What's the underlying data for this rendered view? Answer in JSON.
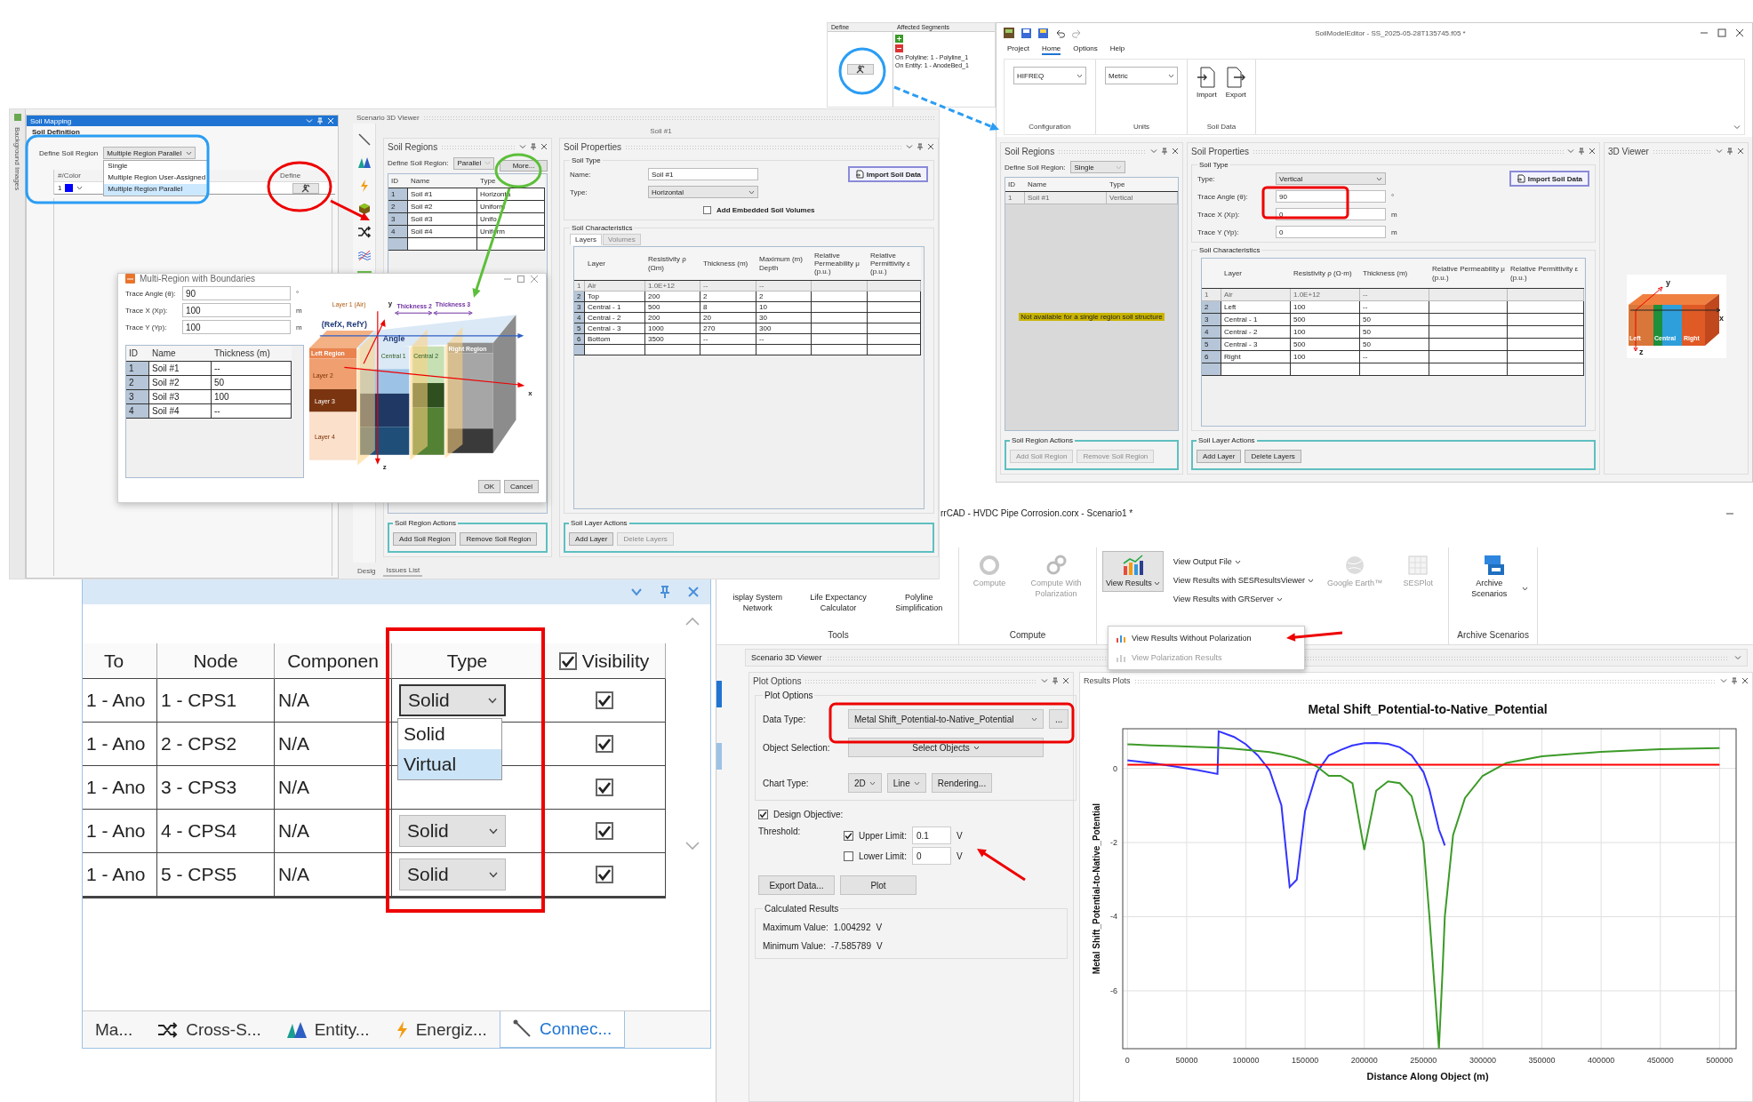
{
  "soil_mapping_screen": {
    "side_tab": "Background Images",
    "soil_mapping": {
      "title": "Soil Mapping",
      "section": "Soil Definition",
      "define_label": "Define Soil Region",
      "define_value": "Multiple Region Parallel",
      "options": [
        {
          "label": "Single",
          "selected": false
        },
        {
          "label": "Multiple Region User-Assigned",
          "selected": false
        },
        {
          "label": "Multiple Region Parallel",
          "selected": true
        }
      ],
      "columns": [
        "#/Color",
        "Define"
      ],
      "rows": [
        {
          "id": "1",
          "color": "#0000ff"
        }
      ]
    },
    "viewer": {
      "title": "Scenario 3D Viewer",
      "caption": "Soil #1",
      "bottom_tabs": [
        {
          "label": "Desig",
          "selected": false
        },
        {
          "label": "Issues List",
          "selected": true
        }
      ]
    },
    "soil_regions": {
      "title": "Soil Regions",
      "define_label": "Define Soil Region:",
      "define_value": "Parallel",
      "more_button": "More...",
      "columns": [
        "ID",
        "Name",
        "Type"
      ],
      "rows": [
        {
          "cells": [
            "1",
            "Soil #1",
            "Horizonta"
          ]
        },
        {
          "cells": [
            "2",
            "Soil #2",
            "Uniform"
          ]
        },
        {
          "cells": [
            "3",
            "Soil #3",
            "Unifo"
          ]
        },
        {
          "cells": [
            "4",
            "Soil #4",
            "Uniform"
          ]
        }
      ],
      "actions_title": "Soil Region Actions",
      "actions": [
        {
          "label": "Add Soil Region",
          "disabled": false
        },
        {
          "label": "Remove Soil Region",
          "disabled": false
        }
      ]
    },
    "soil_properties": {
      "title": "Soil Properties",
      "soil_type_title": "Soil Type",
      "fields": [
        {
          "label": "Name:",
          "value": "Soil #1",
          "kind": "text"
        },
        {
          "label": "Type:",
          "value": "Horizontal",
          "kind": "dropdown"
        }
      ],
      "import_button": "Import Soil Data",
      "embedded": {
        "label": "Add Embedded Soil Volumes",
        "checked": false
      },
      "characteristics_title": "Soil Characteristics",
      "tabs": [
        {
          "label": "Layers",
          "selected": true
        },
        {
          "label": "Volumes",
          "selected": false
        }
      ],
      "columns": [
        "Layer",
        "Resistivity ρ (Ωm)",
        "Thickness (m)",
        "Maximum (m) Depth",
        "Relative Permeability μ (p.u.)",
        "Relative Permittivity ε (p.u.)"
      ],
      "rows": [
        {
          "id": "1",
          "cells": [
            "Air",
            "1.0E+12",
            "--",
            "--"
          ],
          "disabled": true
        },
        {
          "id": "2",
          "cells": [
            "Top",
            "200",
            "2",
            "2"
          ],
          "disabled": false
        },
        {
          "id": "3",
          "cells": [
            "Central - 1",
            "500",
            "8",
            "10"
          ],
          "disabled": false
        },
        {
          "id": "4",
          "cells": [
            "Central - 2",
            "200",
            "20",
            "30"
          ],
          "disabled": false
        },
        {
          "id": "5",
          "cells": [
            "Central - 3",
            "1000",
            "270",
            "300"
          ],
          "disabled": false
        },
        {
          "id": "6",
          "cells": [
            "Bottom",
            "3500",
            "--",
            "--"
          ],
          "disabled": false
        }
      ],
      "actions_title": "Soil Layer Actions",
      "actions": [
        {
          "label": "Add Layer",
          "disabled": false
        },
        {
          "label": "Delete Layers",
          "disabled": true
        }
      ]
    },
    "dialog": {
      "title": "Multi-Region with Boundaries",
      "fields": [
        {
          "label": "Trace Angle (θ):",
          "value": "90",
          "kind": "text",
          "unit": "°"
        },
        {
          "label": "Trace X (Xp):",
          "value": "100",
          "kind": "text",
          "unit": "m"
        },
        {
          "label": "Trace Y (Yp):",
          "value": "100",
          "kind": "text",
          "unit": "m"
        }
      ],
      "columns": [
        "ID",
        "Name",
        "Thickness (m)"
      ],
      "rows": [
        {
          "cells": [
            "1",
            "Soil #1",
            "--"
          ]
        },
        {
          "cells": [
            "2",
            "Soil #2",
            "50"
          ]
        },
        {
          "cells": [
            "3",
            "Soil #3",
            "100"
          ]
        },
        {
          "cells": [
            "4",
            "Soil #4",
            "--"
          ]
        }
      ],
      "diagram_labels": [
        "Layer 1 (Air)",
        "y",
        "Thickness 2",
        "Thickness 3",
        "(RefX, RefY)",
        "Angle",
        "Left Region",
        "Central 1",
        "Central 2",
        "Right Region",
        "Layer 2",
        "x",
        "Layer 3",
        "Layer 4",
        "z"
      ],
      "buttons": [
        "OK",
        "Cancel"
      ]
    }
  },
  "segments_snippet": {
    "columns": [
      "Define",
      "Affected Segments"
    ],
    "segments": [
      "On Polyline: 1 - Polyline_1",
      "On Entity: 1 - AnodeBed_1"
    ]
  },
  "soil_editor": {
    "title": "SoilModelEditor - SS_2025-05-28T135745.f05 *",
    "menu": [
      {
        "label": "Project",
        "selected": false
      },
      {
        "label": "Home",
        "selected": true
      },
      {
        "label": "Options",
        "selected": false
      },
      {
        "label": "Help",
        "selected": false
      }
    ],
    "ribbon": [
      {
        "label": "Configuration",
        "kind": "dropdown",
        "value": "HIFREQ"
      },
      {
        "label": "Units",
        "kind": "dropdown",
        "value": "Metric"
      },
      {
        "label": "Soil Data",
        "kind": "buttons",
        "buttons": [
          "Import",
          "Export"
        ]
      }
    ],
    "soil_regions": {
      "title": "Soil Regions",
      "define_label": "Define Soil Region:",
      "define_value": "Single",
      "columns": [
        "ID",
        "Name",
        "Type"
      ],
      "rows": [
        {
          "cells": [
            "1",
            "Soil #1",
            "Vertical"
          ],
          "disabled": true
        }
      ],
      "notice": "Not available for a single region soil structure",
      "actions_title": "Soil Region Actions",
      "actions": [
        {
          "label": "Add Soil Region",
          "disabled": true
        },
        {
          "label": "Remove Soil Region",
          "disabled": true
        }
      ]
    },
    "soil_properties": {
      "title": "Soil Properties",
      "soil_type_title": "Soil Type",
      "fields": [
        {
          "label": "Type:",
          "value": "Vertical",
          "kind": "dropdown"
        },
        {
          "label": "Trace Angle (θ):",
          "value": "90",
          "kind": "text",
          "unit": "°"
        },
        {
          "label": "Trace X (Xp):",
          "value": "0",
          "kind": "text",
          "unit": "m"
        },
        {
          "label": "Trace Y (Yp):",
          "value": "0",
          "kind": "text",
          "unit": "m"
        }
      ],
      "import_button": "Import Soil Data",
      "characteristics_title": "Soil Characteristics",
      "columns": [
        "Layer",
        "Resistivity ρ (Ω·m)",
        "Thickness (m)",
        "Relative Permeability μ (p.u.)",
        "Relative Permittivity ε (p.u.)"
      ],
      "rows": [
        {
          "id": "1",
          "cells": [
            "Air",
            "1.0E+12",
            "--"
          ],
          "disabled": true
        },
        {
          "id": "2",
          "cells": [
            "Left",
            "100",
            "--"
          ],
          "disabled": false
        },
        {
          "id": "3",
          "cells": [
            "Central - 1",
            "500",
            "50"
          ],
          "disabled": false
        },
        {
          "id": "4",
          "cells": [
            "Central - 2",
            "100",
            "50"
          ],
          "disabled": false
        },
        {
          "id": "5",
          "cells": [
            "Central - 3",
            "500",
            "50"
          ],
          "disabled": false
        },
        {
          "id": "6",
          "cells": [
            "Right",
            "100",
            "--"
          ],
          "disabled": false
        }
      ],
      "actions_title": "Soil Layer Actions",
      "actions": [
        {
          "label": "Add Layer",
          "disabled": false
        },
        {
          "label": "Delete Layers",
          "disabled": false
        }
      ]
    },
    "viewer": {
      "title": "3D Viewer",
      "labels": [
        "y",
        "x",
        "Left",
        "Central",
        "Right",
        "z"
      ]
    }
  },
  "connections_panel": {
    "columns": [
      "To",
      "Node",
      "Componen",
      "Type"
    ],
    "visibility": {
      "label": "Visibility",
      "checked": true
    },
    "rows": [
      {
        "to": "1 - Ano",
        "node": "1 - CPS1",
        "component": "N/A",
        "type": "Solid",
        "open": true,
        "options": [
          {
            "label": "Solid",
            "selected": false
          },
          {
            "label": "Virtual",
            "selected": true
          }
        ],
        "visible": true
      },
      {
        "to": "1 - Ano",
        "node": "2 - CPS2",
        "component": "N/A",
        "open": false,
        "visible": true
      },
      {
        "to": "1 - Ano",
        "node": "3 - CPS3",
        "component": "N/A",
        "open": false,
        "visible": true
      },
      {
        "to": "1 - Ano",
        "node": "4 - CPS4",
        "component": "N/A",
        "type": "Solid",
        "open": false,
        "visible": true
      },
      {
        "to": "1 - Ano",
        "node": "5 - CPS5",
        "component": "N/A",
        "type": "Solid",
        "open": false,
        "visible": true
      }
    ],
    "bottom_tabs": [
      {
        "label": "Ma...",
        "selected": false
      },
      {
        "label": "Cross-S...",
        "selected": false
      },
      {
        "label": "Entity...",
        "selected": false
      },
      {
        "label": "Energiz...",
        "selected": false
      },
      {
        "label": "Connec...",
        "selected": true
      }
    ]
  },
  "corrcad": {
    "title": "rrCAD - HVDC Pipe Corrosion.corx - Scenario1 *",
    "ribbon": [
      {
        "label": "Tools",
        "items": [
          {
            "label": "isplay System Network",
            "kind": "large",
            "disabled": false,
            "caret": false,
            "pressed": false
          },
          {
            "label": "Life Expectancy Calculator",
            "kind": "large",
            "disabled": false,
            "caret": false,
            "pressed": false
          },
          {
            "label": "Polyline Simplification",
            "kind": "large",
            "disabled": false,
            "caret": false,
            "pressed": false
          }
        ]
      },
      {
        "label": "Compute",
        "items": [
          {
            "label": "Compute",
            "kind": "large",
            "disabled": true,
            "caret": false,
            "pressed": false
          },
          {
            "label": "Compute With Polarization",
            "kind": "large",
            "disabled": true,
            "caret": false,
            "pressed": false
          }
        ]
      },
      {
        "items": [
          {
            "label": "View Results",
            "kind": "large",
            "disabled": false,
            "caret": true,
            "pressed": true
          },
          {
            "label": "View Output File",
            "kind": "small",
            "disabled": false,
            "caret": true,
            "pressed": false
          },
          {
            "label": "View Results with SESResultsViewer",
            "kind": "small",
            "disabled": false,
            "caret": true,
            "pressed": false
          },
          {
            "label": "View Results with GRServer",
            "kind": "small",
            "disabled": false,
            "caret": true,
            "pressed": false
          },
          {
            "label": "Google Earth™",
            "kind": "large",
            "disabled": true,
            "caret": false,
            "pressed": false
          },
          {
            "label": "SESPlot",
            "kind": "large",
            "disabled": true,
            "caret": false,
            "pressed": false
          }
        ]
      },
      {
        "label": "Archive Scenarios",
        "items": [
          {
            "label": "Archive Scenarios",
            "kind": "large",
            "disabled": false,
            "caret": true,
            "pressed": false
          }
        ]
      }
    ],
    "menu": [
      {
        "label": "View Results Without Polarization",
        "disabled": false
      },
      {
        "label": "View Polarization Results",
        "disabled": true
      }
    ],
    "viewer_tab": "Scenario 3D Viewer",
    "plot_options": {
      "title": "Plot Options",
      "group": "Plot Options",
      "data_type": {
        "label": "Data Type:",
        "value": "Metal Shift_Potential-to-Native_Potential",
        "more": "..."
      },
      "object_selection": {
        "label": "Object Selection:",
        "value": "Select Objects"
      },
      "chart_type": {
        "label": "Chart Type:",
        "dimension": "2D",
        "style": "Line",
        "rendering": "Rendering..."
      },
      "design_objective": {
        "label": "Design Objective:",
        "checked": true
      },
      "threshold": {
        "label": "Threshold:",
        "limits": [
          {
            "label": "Upper Limit:",
            "checked": true,
            "value": "0.1",
            "unit": "V"
          },
          {
            "label": "Lower Limit:",
            "checked": false,
            "value": "0",
            "unit": "V"
          }
        ]
      },
      "buttons": [
        "Export Data...",
        "Plot"
      ],
      "results_group": "Calculated Results",
      "results": [
        {
          "label": "Maximum Value:",
          "value": "1.004292",
          "unit": "V"
        },
        {
          "label": "Minimum Value:",
          "value": "-7.585789",
          "unit": "V"
        }
      ]
    },
    "results": {
      "title": "Results Plots",
      "chart_data": {
        "type": "line",
        "title": "Metal Shift_Potential-to-Native_Potential",
        "xlabel": "Distance Along Object (m)",
        "ylabel": "Metal Shift_Potential-to-Native_Potential",
        "x": [
          0,
          20000,
          40000,
          60000,
          76000,
          77000,
          90000,
          100000,
          110000,
          120000,
          130000,
          137000,
          143000,
          150000,
          160000,
          170000,
          180000,
          190000,
          200000,
          210000,
          220000,
          230000,
          240000,
          250000,
          255000,
          260000,
          263000,
          266000,
          268000,
          275000,
          285000,
          300000,
          320000,
          350000,
          400000,
          450000,
          500000
        ],
        "series": [
          {
            "color": "#3333ff",
            "values": [
              0.22,
              0.15,
              0.05,
              -0.05,
              -0.15,
              1.0,
              0.85,
              0.65,
              0.35,
              -0.05,
              -1.0,
              -3.2,
              -3.0,
              -1.15,
              -0.1,
              0.35,
              0.5,
              0.62,
              0.68,
              0.69,
              0.66,
              0.57,
              0.35,
              -0.1,
              -0.57,
              -1.25,
              -1.65,
              -1.9,
              -2.08,
              null,
              null,
              null,
              null,
              null,
              null,
              null,
              null
            ]
          },
          {
            "color": "#3c9a28",
            "values": [
              0.65,
              0.62,
              0.6,
              0.58,
              0.56,
              0.56,
              0.53,
              0.5,
              0.47,
              0.44,
              0.38,
              0.33,
              0.28,
              0.2,
              0.05,
              -0.2,
              -0.2,
              -0.4,
              -2.2,
              -0.6,
              -0.35,
              -0.4,
              -0.75,
              -2.0,
              -4.0,
              -6.2,
              -7.55,
              -5.5,
              -4.0,
              -1.8,
              -0.8,
              -0.2,
              0.15,
              0.33,
              0.45,
              0.52,
              0.55
            ]
          },
          {
            "color": "#ff0000",
            "values": [
              0.1,
              0.1,
              0.1,
              0.1,
              0.1,
              0.1,
              0.1,
              0.1,
              0.1,
              0.1,
              0.1,
              0.1,
              0.1,
              0.1,
              0.1,
              0.1,
              0.1,
              0.1,
              0.1,
              0.1,
              0.1,
              0.1,
              0.1,
              0.1,
              0.1,
              0.1,
              0.1,
              0.1,
              0.1,
              0.1,
              0.1,
              0.1,
              0.1,
              0.1,
              0.1,
              0.1,
              0.1
            ]
          }
        ],
        "grid": true,
        "xlim": [
          -4000,
          514000
        ],
        "ylim": [
          -7.56,
          1.07
        ],
        "xticks": [
          0,
          50000,
          100000,
          150000,
          200000,
          250000,
          300000,
          350000,
          400000,
          450000,
          500000
        ],
        "yticks": [
          -6,
          -4,
          -2,
          0
        ]
      }
    }
  }
}
